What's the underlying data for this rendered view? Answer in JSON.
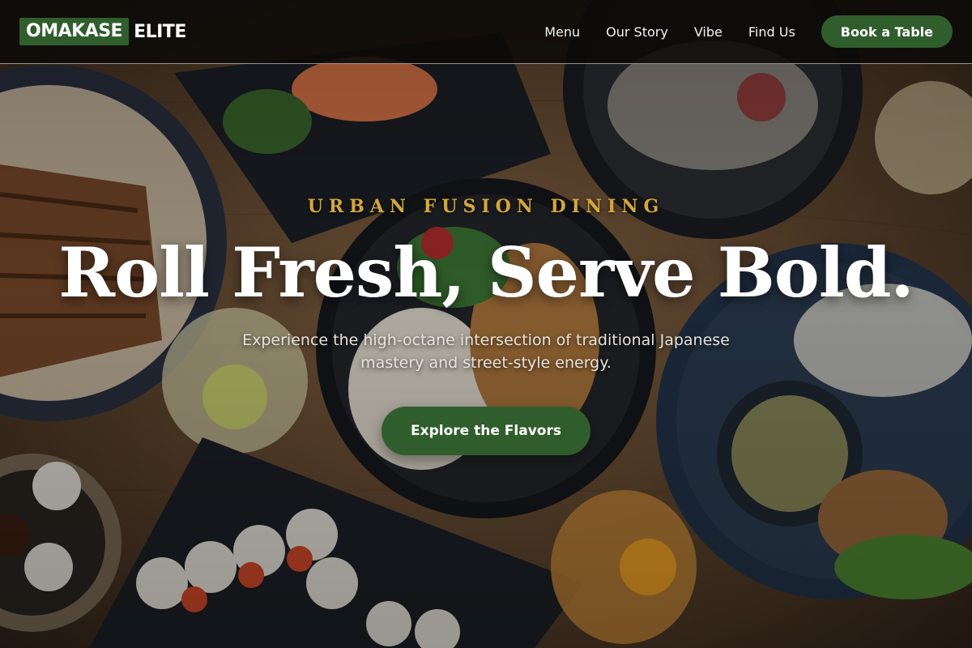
{
  "brand": {
    "logo_boxed": "OMAKASE",
    "logo_text": "ELITE",
    "accent_color": "#2f5e2c",
    "eyebrow_color": "#d4a73a"
  },
  "nav": {
    "items": [
      {
        "label": "Menu"
      },
      {
        "label": "Our Story"
      },
      {
        "label": "Vibe"
      },
      {
        "label": "Find Us"
      }
    ],
    "book_label": "Book a Table"
  },
  "hero": {
    "eyebrow": "URBAN FUSION DINING",
    "headline": "Roll Fresh, Serve Bold.",
    "subhead": "Experience the high-octane intersection of traditional Japanese mastery and street-style energy.",
    "cta_label": "Explore the Flavors",
    "background": "food-spread-photo"
  }
}
